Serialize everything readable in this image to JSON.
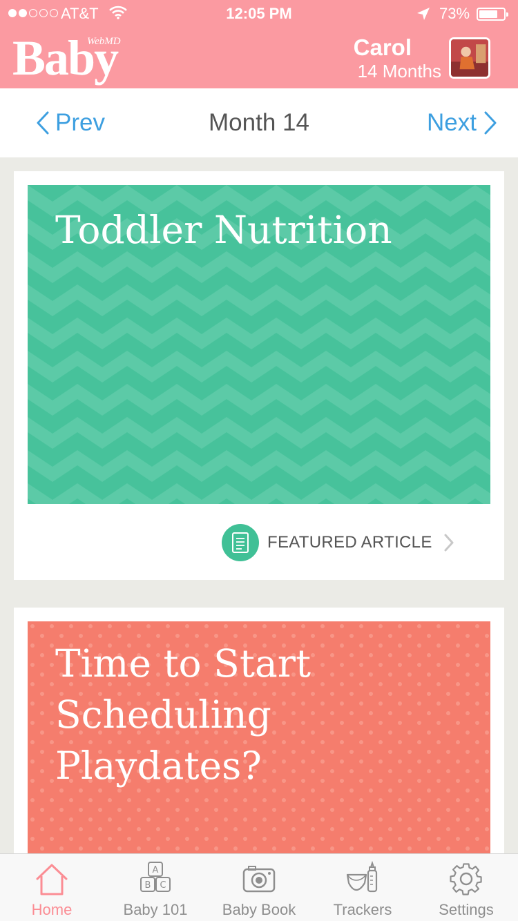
{
  "status_bar": {
    "carrier": "AT&T",
    "time": "12:05 PM",
    "battery": "73%",
    "signal_bars_filled": 2,
    "signal_bars_total": 5
  },
  "header": {
    "logo_text": "Baby",
    "logo_brand": "WebMD",
    "user_name": "Carol",
    "user_age": "14 Months"
  },
  "month_nav": {
    "prev_label": "Prev",
    "title": "Month 14",
    "next_label": "Next"
  },
  "cards": [
    {
      "title": "Toddler Nutrition",
      "color": "#47c29b",
      "pattern": "chevron",
      "tag_label": "FEATURED ARTICLE",
      "tag_icon": "document-icon"
    },
    {
      "title": "Time to Start Scheduling Playdates?",
      "color": "#f57d6d",
      "pattern": "polka-dot"
    }
  ],
  "tabbar": {
    "items": [
      {
        "label": "Home",
        "icon": "home-icon",
        "active": true
      },
      {
        "label": "Baby 101",
        "icon": "abc-blocks-icon",
        "active": false
      },
      {
        "label": "Baby Book",
        "icon": "camera-icon",
        "active": false
      },
      {
        "label": "Trackers",
        "icon": "diaper-bottle-icon",
        "active": false
      },
      {
        "label": "Settings",
        "icon": "gear-icon",
        "active": false
      }
    ]
  },
  "colors": {
    "header_bg": "#fb9aa1",
    "link_blue": "#3d9fe0",
    "active_tab": "#fb8d94",
    "page_bg": "#ebebe6"
  }
}
